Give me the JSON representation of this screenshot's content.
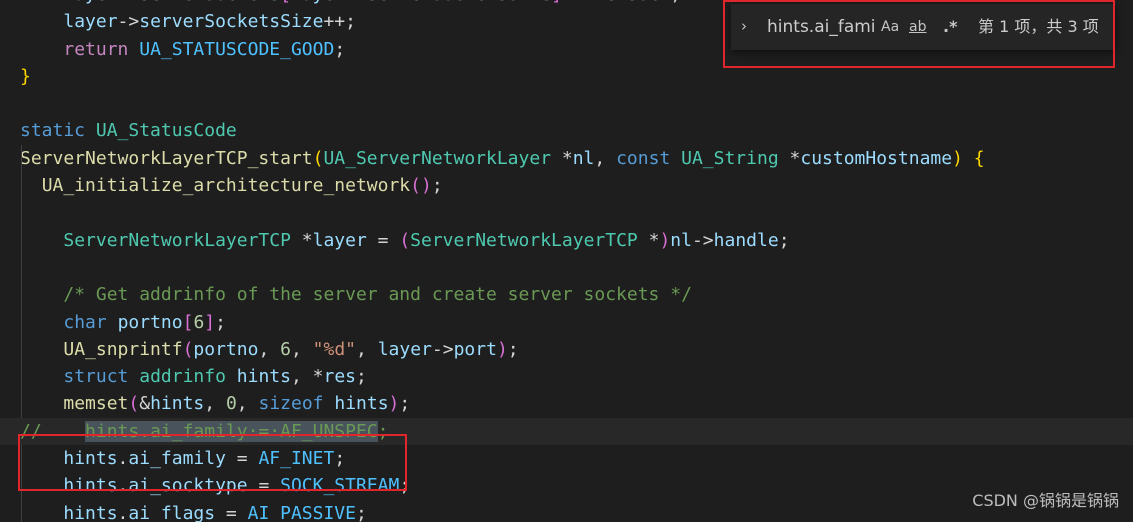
{
  "editor": {
    "lines": [
      [
        [
          "    ",
          "p"
        ],
        [
          "layer",
          "var"
        ],
        [
          "->",
          "p"
        ],
        [
          "serverSockets",
          "var"
        ],
        [
          "[",
          "b2"
        ],
        [
          "layer",
          "var"
        ],
        [
          "->",
          "p"
        ],
        [
          "serverSocketsSize",
          "var"
        ],
        [
          "]",
          "b2"
        ],
        [
          " = ",
          "p"
        ],
        [
          "newsock",
          "var"
        ],
        [
          ";",
          "p"
        ]
      ],
      [
        [
          "    ",
          "p"
        ],
        [
          "layer",
          "var"
        ],
        [
          "->",
          "p"
        ],
        [
          "serverSocketsSize",
          "var"
        ],
        [
          "++;",
          "p"
        ]
      ],
      [
        [
          "    ",
          "p"
        ],
        [
          "return",
          "ctl"
        ],
        [
          " ",
          "p"
        ],
        [
          "UA_STATUSCODE_GOOD",
          "mac"
        ],
        [
          ";",
          "p"
        ]
      ],
      [
        [
          "}",
          "b1"
        ]
      ],
      [],
      [
        [
          "static",
          "kw"
        ],
        [
          " ",
          "p"
        ],
        [
          "UA_StatusCode",
          "type"
        ]
      ],
      [
        [
          "ServerNetworkLayerTCP_start",
          "fn"
        ],
        [
          "(",
          "b1"
        ],
        [
          "UA_ServerNetworkLayer",
          "type"
        ],
        [
          " *",
          "p"
        ],
        [
          "nl",
          "var"
        ],
        [
          ", ",
          "p"
        ],
        [
          "const",
          "kw"
        ],
        [
          " ",
          "p"
        ],
        [
          "UA_String",
          "type"
        ],
        [
          " *",
          "p"
        ],
        [
          "customHostname",
          "var"
        ],
        [
          ")",
          "b1"
        ],
        [
          " ",
          "p"
        ],
        [
          "{",
          "b1"
        ]
      ],
      [
        [
          "  ",
          "p"
        ],
        [
          "UA_initialize_architecture_network",
          "fn"
        ],
        [
          "()",
          "b2"
        ],
        [
          ";",
          "p"
        ]
      ],
      [],
      [
        [
          "    ",
          "p"
        ],
        [
          "ServerNetworkLayerTCP",
          "type"
        ],
        [
          " *",
          "p"
        ],
        [
          "layer",
          "var"
        ],
        [
          " = ",
          "p"
        ],
        [
          "(",
          "b2"
        ],
        [
          "ServerNetworkLayerTCP",
          "type"
        ],
        [
          " *",
          "p"
        ],
        [
          ")",
          "b2"
        ],
        [
          "nl",
          "var"
        ],
        [
          "->",
          "p"
        ],
        [
          "handle",
          "var"
        ],
        [
          ";",
          "p"
        ]
      ],
      [],
      [
        [
          "    ",
          "p"
        ],
        [
          "/* Get addrinfo of the server and create server sockets */",
          "cmt"
        ]
      ],
      [
        [
          "    ",
          "p"
        ],
        [
          "char",
          "kw"
        ],
        [
          " ",
          "p"
        ],
        [
          "portno",
          "var"
        ],
        [
          "[",
          "b2"
        ],
        [
          "6",
          "num"
        ],
        [
          "]",
          "b2"
        ],
        [
          ";",
          "p"
        ]
      ],
      [
        [
          "    ",
          "p"
        ],
        [
          "UA_snprintf",
          "fn"
        ],
        [
          "(",
          "b2"
        ],
        [
          "portno",
          "var"
        ],
        [
          ", ",
          "p"
        ],
        [
          "6",
          "num"
        ],
        [
          ", ",
          "p"
        ],
        [
          "\"%d\"",
          "str"
        ],
        [
          ", ",
          "p"
        ],
        [
          "layer",
          "var"
        ],
        [
          "->",
          "p"
        ],
        [
          "port",
          "var"
        ],
        [
          ")",
          "b2"
        ],
        [
          ";",
          "p"
        ]
      ],
      [
        [
          "    ",
          "p"
        ],
        [
          "struct",
          "kw"
        ],
        [
          " ",
          "p"
        ],
        [
          "addrinfo",
          "type"
        ],
        [
          " ",
          "p"
        ],
        [
          "hints",
          "var"
        ],
        [
          ", *",
          "p"
        ],
        [
          "res",
          "var"
        ],
        [
          ";",
          "p"
        ]
      ],
      [
        [
          "    ",
          "p"
        ],
        [
          "memset",
          "fn"
        ],
        [
          "(",
          "b2"
        ],
        [
          "&",
          "p"
        ],
        [
          "hints",
          "var"
        ],
        [
          ", ",
          "p"
        ],
        [
          "0",
          "num"
        ],
        [
          ", ",
          "p"
        ],
        [
          "sizeof",
          "kw"
        ],
        [
          " ",
          "p"
        ],
        [
          "hints",
          "var"
        ],
        [
          ")",
          "b2"
        ],
        [
          ";",
          "p"
        ]
      ],
      [
        [
          "//",
          "cmt"
        ],
        [
          "    ",
          "cmt"
        ],
        [
          "hints.ai_family·=·AF_UNSPEC",
          "match"
        ],
        [
          ";",
          "cmt"
        ]
      ],
      [
        [
          "    ",
          "p"
        ],
        [
          "hints",
          "var"
        ],
        [
          ".",
          "p"
        ],
        [
          "ai_family",
          "var"
        ],
        [
          " = ",
          "p"
        ],
        [
          "AF_INET",
          "mac"
        ],
        [
          ";",
          "p"
        ]
      ],
      [
        [
          "    ",
          "p"
        ],
        [
          "hints",
          "var"
        ],
        [
          ".",
          "p"
        ],
        [
          "ai_socktype",
          "var"
        ],
        [
          " = ",
          "p"
        ],
        [
          "SOCK_STREAM",
          "mac"
        ],
        [
          ";",
          "p"
        ]
      ],
      [
        [
          "    ",
          "p"
        ],
        [
          "hints",
          "var"
        ],
        [
          ".",
          "p"
        ],
        [
          "ai_flags",
          "var"
        ],
        [
          " = ",
          "p"
        ],
        [
          "AI_PASSIVE",
          "mac"
        ],
        [
          ";",
          "p"
        ]
      ]
    ],
    "current_line": 16
  },
  "find": {
    "toggle_glyph": "›",
    "query": "hints.ai_fami",
    "match_case_label": "Aa",
    "whole_word_label": "ab",
    "regex_label": ".*",
    "result_count": "第 1 项，共 3 项"
  },
  "watermark": "CSDN @锅锅是锅锅",
  "colors": {
    "background": "#1e1e1e",
    "keyword": "#569cd6",
    "control": "#c586c0",
    "type": "#4ec9b0",
    "function": "#dcdcaa",
    "variable": "#9cdcfe",
    "macro": "#4fc1ff",
    "number": "#b5cea8",
    "string": "#ce9178",
    "comment": "#6a9955",
    "annotation_box": "#e0262b"
  }
}
